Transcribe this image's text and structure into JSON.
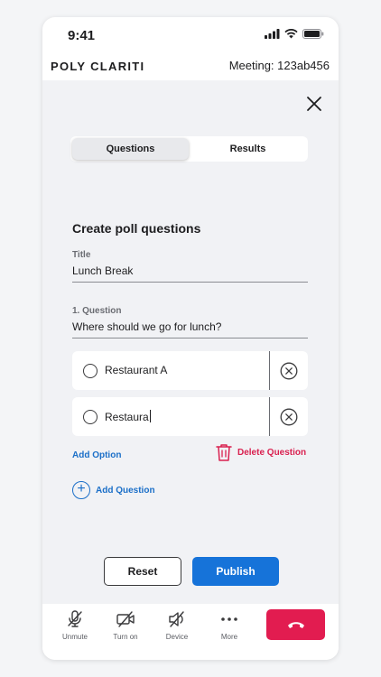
{
  "status_bar": {
    "time": "9:41"
  },
  "header": {
    "brand": "POLY CLARITI",
    "meeting": "Meeting: 123ab456"
  },
  "poll": {
    "tabs": [
      {
        "label": "Questions"
      },
      {
        "label": "Results"
      }
    ],
    "section_title": "Create poll questions",
    "title_label": "Title",
    "title_value": "Lunch Break",
    "question_label": "1. Question",
    "question_value": "Where should we go for lunch?",
    "options": [
      {
        "text": "Restaurant A"
      },
      {
        "text": "Restaura"
      }
    ],
    "add_option": "Add Option",
    "delete_question": "Delete Question",
    "add_question": "Add Question",
    "reset": "Reset",
    "publish": "Publish"
  },
  "toolbar": {
    "items": [
      {
        "label": "Unmute",
        "icon": "mic-off-icon"
      },
      {
        "label": "Turn on",
        "icon": "video-off-icon"
      },
      {
        "label": "Device",
        "icon": "speaker-off-icon"
      },
      {
        "label": "More",
        "icon": "more-icon"
      }
    ],
    "end_call_icon": "end-call-icon"
  },
  "colors": {
    "accent": "#1673d9",
    "link": "#1b6fc8",
    "danger": "#e21c50",
    "delete_text": "#d9204f",
    "panel_bg": "#f1f2f5"
  }
}
